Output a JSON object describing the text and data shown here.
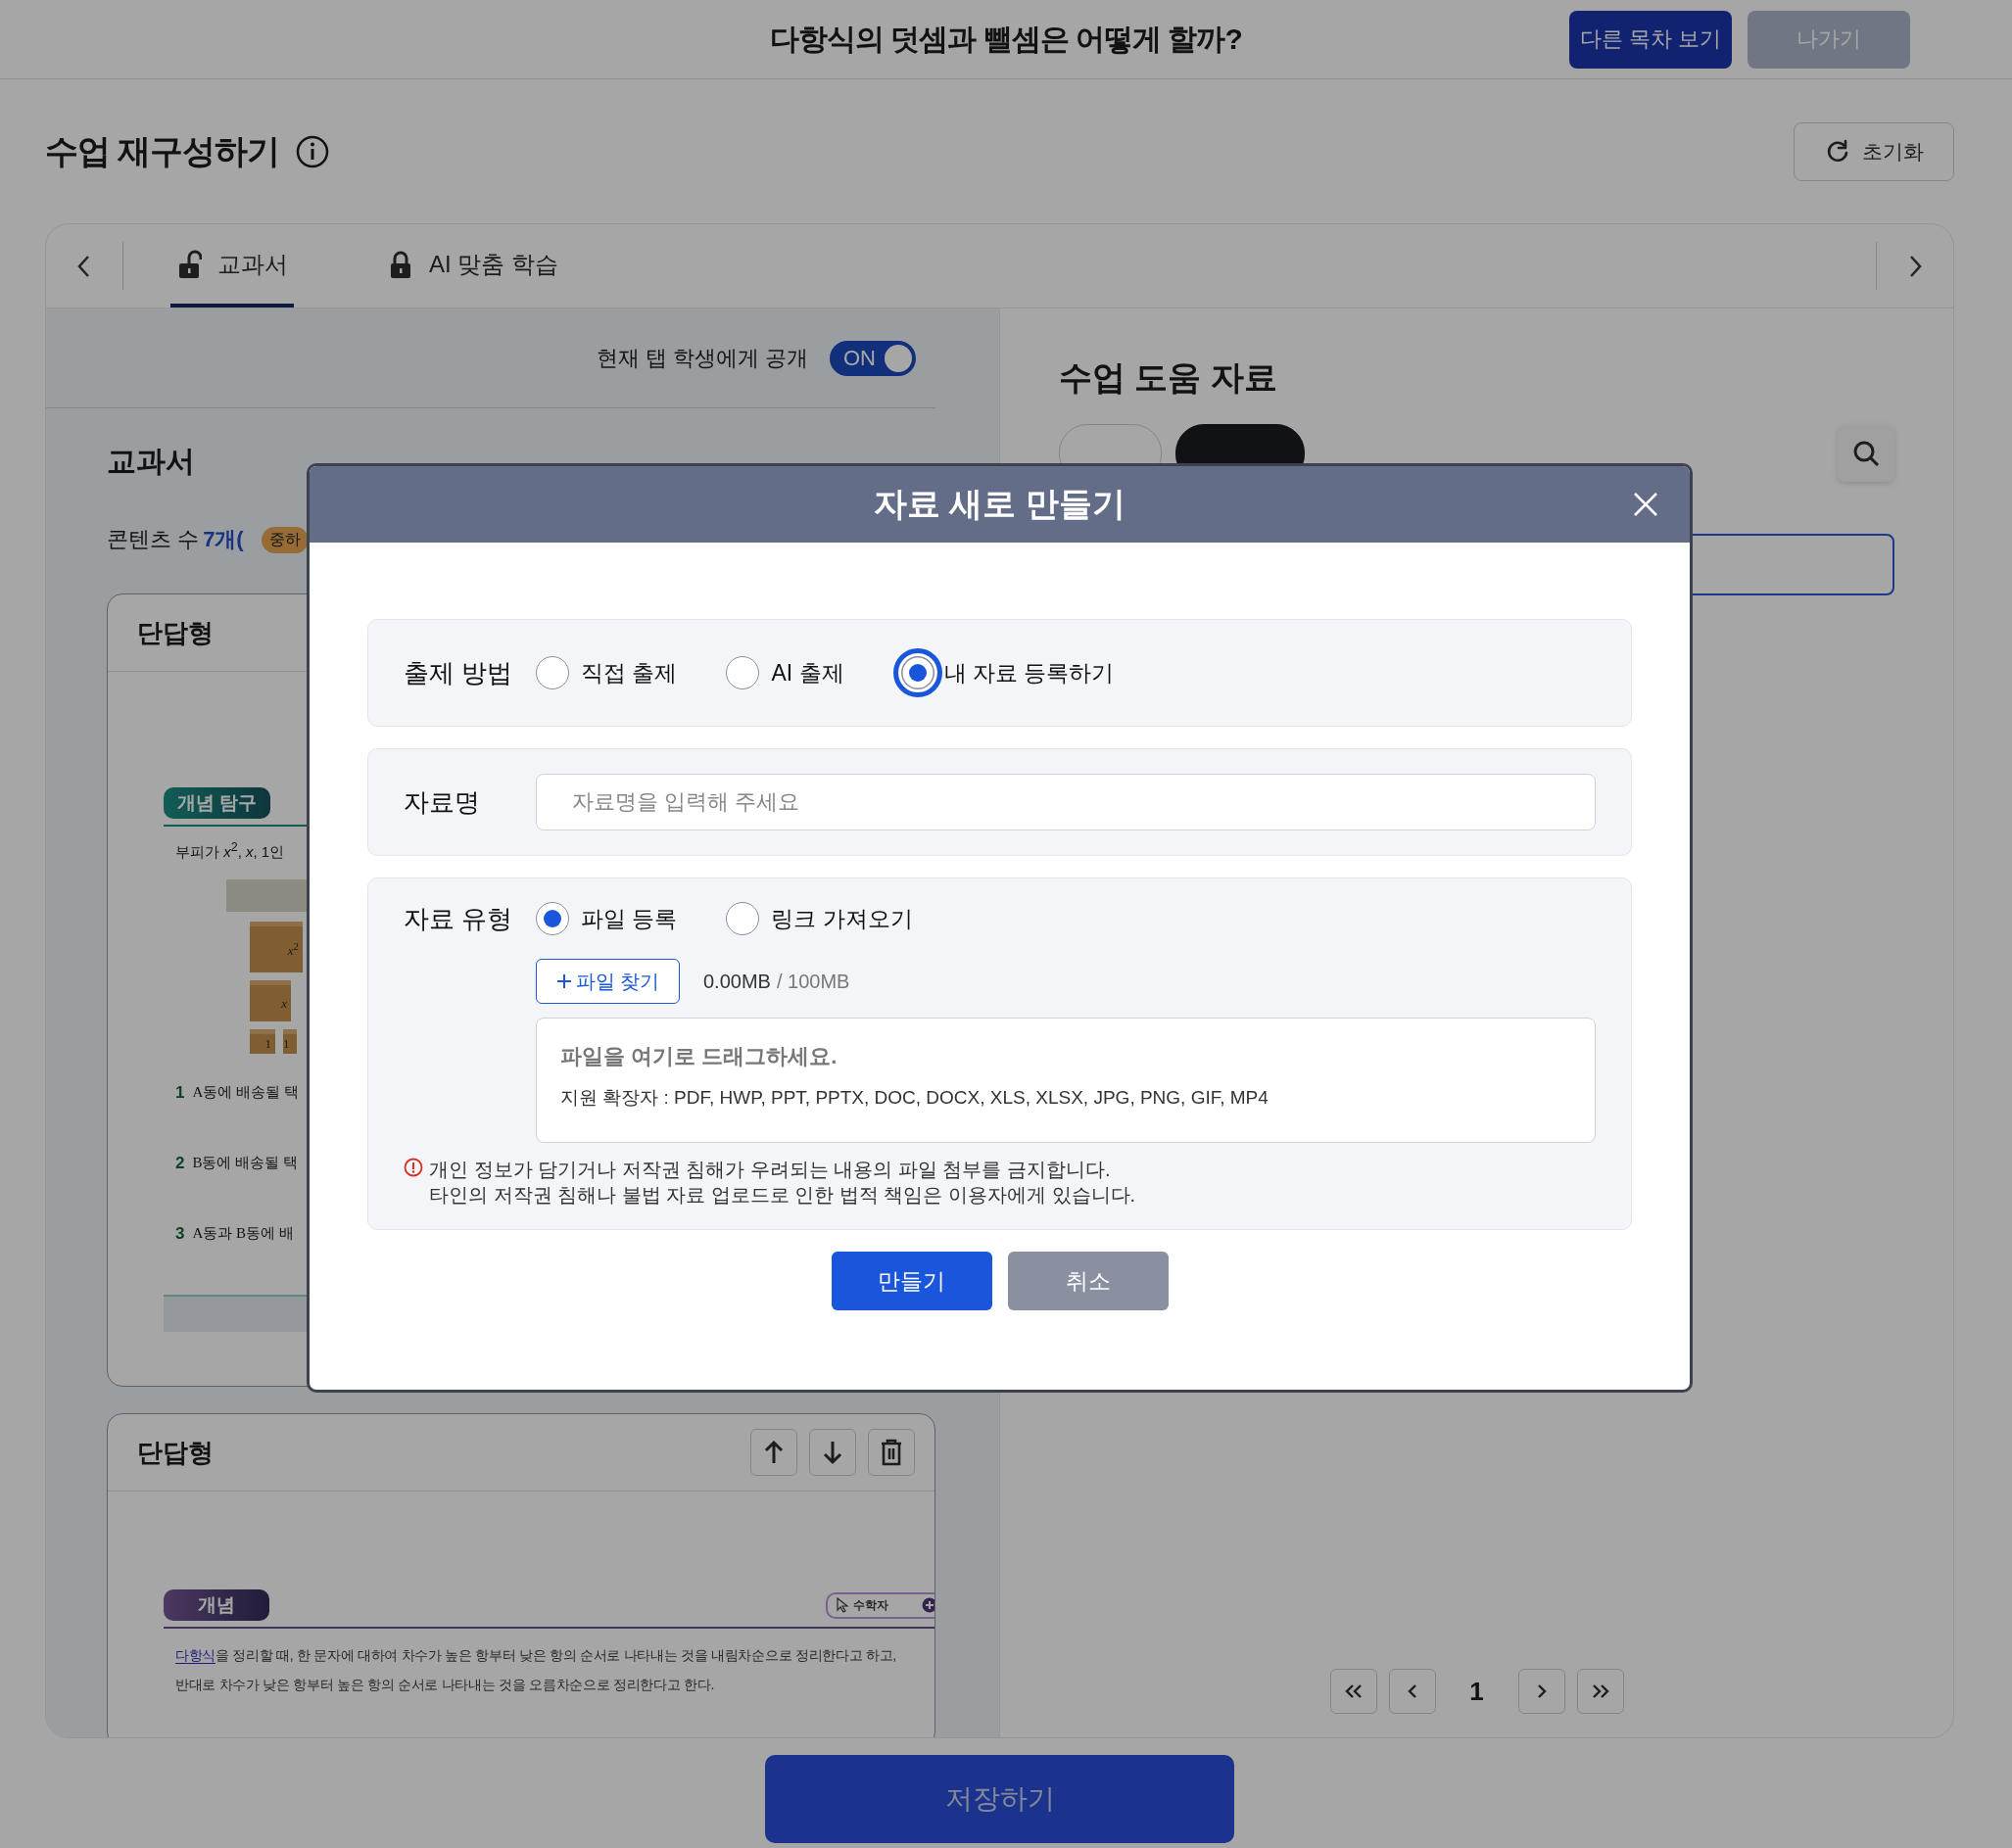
{
  "header": {
    "title": "다항식의 덧셈과 뺄셈은 어떻게 할까?",
    "buttons": [
      {
        "label": "다른 목차 보기",
        "kind": "primary"
      },
      {
        "label": "나가기",
        "kind": "secondary"
      }
    ]
  },
  "page": {
    "title": "수업 재구성하기",
    "reset_button": "초기화"
  },
  "tabs": [
    {
      "label": "교과서",
      "selected": true,
      "locked": false
    },
    {
      "label": "AI 맞춤 학습",
      "selected": false,
      "locked": true
    }
  ],
  "textbook": {
    "toggle": {
      "label": "현재 탭 학생에게 공개",
      "on": true,
      "text": "ON"
    },
    "heading": "교과서",
    "count_label": "콘텐츠 수",
    "count": "7개(",
    "level_badge": "중하",
    "cards": [
      {
        "kind": "explore",
        "title": "단답형",
        "badge": "개념 탐구",
        "intro": "부피가 *x*$^{2}$, *x*, 1인",
        "boxes": [
          [
            "*x*$^{2}$"
          ],
          [
            "*x*"
          ],
          [
            "1",
            "1"
          ]
        ],
        "questions": [
          {
            "number": "1",
            "text": "A동에 배송될 택"
          },
          {
            "number": "2",
            "text": "B동에 배송될 택"
          },
          {
            "number": "3",
            "text": "A동과 B동에 배"
          }
        ]
      },
      {
        "kind": "concept",
        "title": "단답형",
        "badge": "개념",
        "chip": "수학자",
        "link": "다항식",
        "text": "을 정리할 때, 한 문자에 대하여 차수가 높은 항부터 낮은 항의 순서로 나타내는 것을 내림차순으로 정리한다고 하고, 반대로 차수가 낮은 항부터 높은 항의 순서로 나타내는 것을 오름차순으로 정리한다고 한다."
      }
    ]
  },
  "materials": {
    "heading": "수업 도움 자료",
    "filter_tabs": [
      {
        "selected": false
      },
      {
        "selected": true
      }
    ],
    "pagination": {
      "current": "1"
    }
  },
  "save_button": "저장하기",
  "dialog": {
    "title": "자료 새로 만들기",
    "method": {
      "label": "출제 방법",
      "options": [
        {
          "label": "직접 출제",
          "selected": false
        },
        {
          "label": "AI 출제",
          "selected": false
        },
        {
          "label": "내 자료 등록하기",
          "selected": true
        }
      ]
    },
    "name": {
      "label": "자료명",
      "placeholder": "자료명을 입력해 주세요"
    },
    "type": {
      "label": "자료 유형",
      "options": [
        {
          "label": "파일 등록",
          "selected": true
        },
        {
          "label": "링크 가져오기",
          "selected": false
        }
      ],
      "find_button": "파일 찾기",
      "size_used": "0.00MB",
      "size_limit": "/ 100MB",
      "drop_title": "파일을 여기로 드래그하세요.",
      "drop_hint": "지원 확장자 : PDF, HWP, PPT, PPTX, DOC, DOCX, XLS, XLSX, JPG, PNG, GIF, MP4",
      "warning": [
        "개인 정보가 담기거나 저작권 침해가 우려되는 내용의 파일 첨부를 금지합니다.",
        "타인의 저작권 침해나 불법 자료 업로드로 인한 법적 책임은 이용자에게 있습니다."
      ]
    },
    "buttons": [
      {
        "label": "만들기",
        "kind": "primary"
      },
      {
        "label": "취소",
        "kind": "secondary"
      }
    ]
  }
}
